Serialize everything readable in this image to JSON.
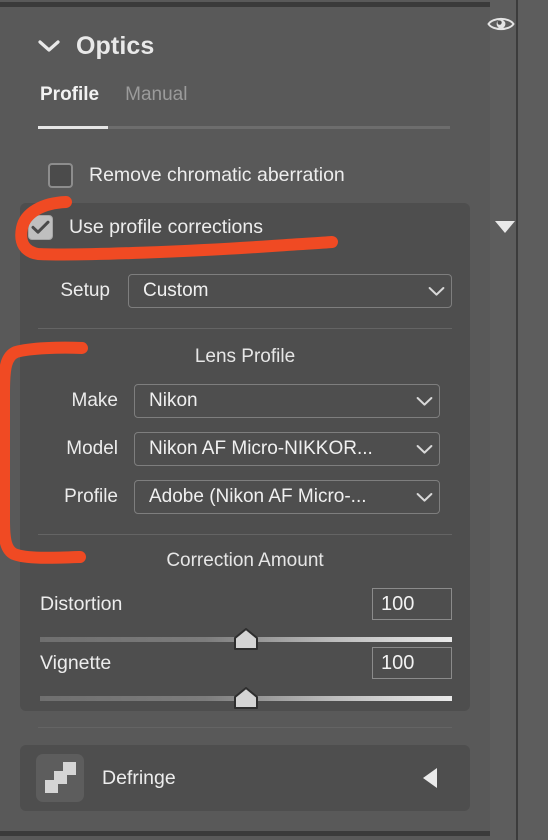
{
  "panel": {
    "header": {
      "title": "Optics",
      "twisty_icon": "chevron-down-icon",
      "visibility_icon": "eye-icon"
    },
    "tabs": [
      {
        "label": "Profile",
        "active": true
      },
      {
        "label": "Manual",
        "active": false
      }
    ],
    "checkboxes": {
      "remove_chromatic_aberration": {
        "label": "Remove chromatic aberration",
        "checked": false
      },
      "use_profile_corrections": {
        "label": "Use profile corrections",
        "checked": true,
        "disclosure_icon": "triangle-down-icon"
      }
    },
    "setup": {
      "label": "Setup",
      "value": "Custom",
      "caret_icon": "chevron-down-icon"
    },
    "lens_profile": {
      "caption": "Lens Profile",
      "fields": [
        {
          "label": "Make",
          "value": "Nikon",
          "caret_icon": "chevron-down-icon"
        },
        {
          "label": "Model",
          "value": "Nikon AF Micro-NIKKOR...",
          "caret_icon": "chevron-down-icon"
        },
        {
          "label": "Profile",
          "value": "Adobe (Nikon AF Micro-...",
          "caret_icon": "chevron-down-icon"
        }
      ]
    },
    "correction_amount": {
      "caption": "Correction Amount",
      "sliders": [
        {
          "label": "Distortion",
          "value": "100",
          "position_pct": 50
        },
        {
          "label": "Vignette",
          "value": "100",
          "position_pct": 50
        }
      ]
    },
    "defringe": {
      "label": "Defringe",
      "icon": "defringe-steps-icon",
      "caret_icon": "triangle-left-icon"
    }
  },
  "annotation": {
    "color": "#f04a23",
    "shapes": [
      {
        "name": "highlight-use-profile-corrections",
        "style": "hook-underline"
      },
      {
        "name": "bracket-lens-profile-fields",
        "style": "left-bracket"
      }
    ]
  },
  "colors": {
    "panel_bg": "#595959",
    "subpanel_bg": "#4e4e4e",
    "text_primary": "#ededed",
    "text_muted": "#9b9b9b",
    "accent_red": "#f04a23"
  }
}
